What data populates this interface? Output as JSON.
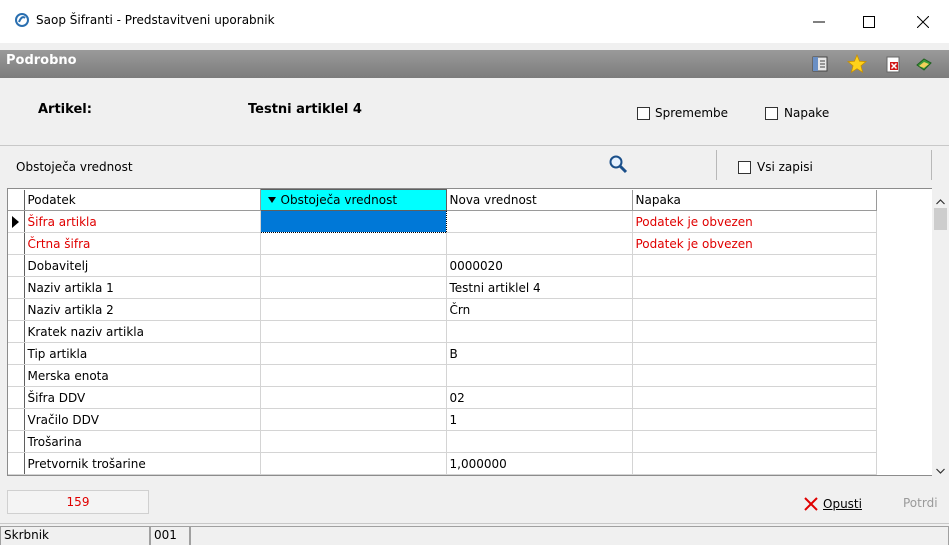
{
  "window": {
    "title": "Saop Šifranti - Predstavitveni uporabnik"
  },
  "header": {
    "title": "Podrobno"
  },
  "toolbar_icons": [
    "layout-icon",
    "star-icon",
    "delete-icon",
    "exit-icon"
  ],
  "artikel": {
    "label": "Artikel:",
    "value": "Testni artiklel 4"
  },
  "checks": {
    "spremembe": "Spremembe",
    "napake": "Napake",
    "vsi_zapisi": "Vsi zapisi"
  },
  "filter": {
    "label": "Obstoječa vrednost"
  },
  "grid": {
    "columns": [
      "Podatek",
      "Obstoječa vrednost",
      "Nova vrednost",
      "Napaka"
    ],
    "rows": [
      {
        "podatek": "Šifra artikla",
        "obstojeca": "",
        "nova": "",
        "napaka": "Podatek je obvezen"
      },
      {
        "podatek": "Črtna šifra",
        "obstojeca": "",
        "nova": "",
        "napaka": "Podatek je obvezen"
      },
      {
        "podatek": "Dobavitelj",
        "obstojeca": "",
        "nova": "0000020",
        "napaka": ""
      },
      {
        "podatek": "Naziv artikla 1",
        "obstojeca": "",
        "nova": "Testni artiklel 4",
        "napaka": ""
      },
      {
        "podatek": "Naziv artikla 2",
        "obstojeca": "",
        "nova": "Črn",
        "napaka": ""
      },
      {
        "podatek": "Kratek naziv artikla",
        "obstojeca": "",
        "nova": "",
        "napaka": ""
      },
      {
        "podatek": "Tip artikla",
        "obstojeca": "",
        "nova": "B",
        "napaka": ""
      },
      {
        "podatek": "Merska enota",
        "obstojeca": "",
        "nova": "",
        "napaka": ""
      },
      {
        "podatek": "Šifra DDV",
        "obstojeca": "",
        "nova": "02",
        "napaka": ""
      },
      {
        "podatek": "Vračilo DDV",
        "obstojeca": "",
        "nova": "1",
        "napaka": ""
      },
      {
        "podatek": "Trošarina",
        "obstojeca": "",
        "nova": "",
        "napaka": ""
      },
      {
        "podatek": "Pretvornik trošarine",
        "obstojeca": "",
        "nova": "1,000000",
        "napaka": ""
      }
    ]
  },
  "footer": {
    "count": "159",
    "opusti": "Opusti",
    "potrdi": "Potrdi"
  },
  "status": {
    "user_label": "Skrbnik",
    "code": "001"
  },
  "colors": {
    "error": "#e00000",
    "sorted_header": "#00ffff",
    "selection": "#0078d7"
  }
}
